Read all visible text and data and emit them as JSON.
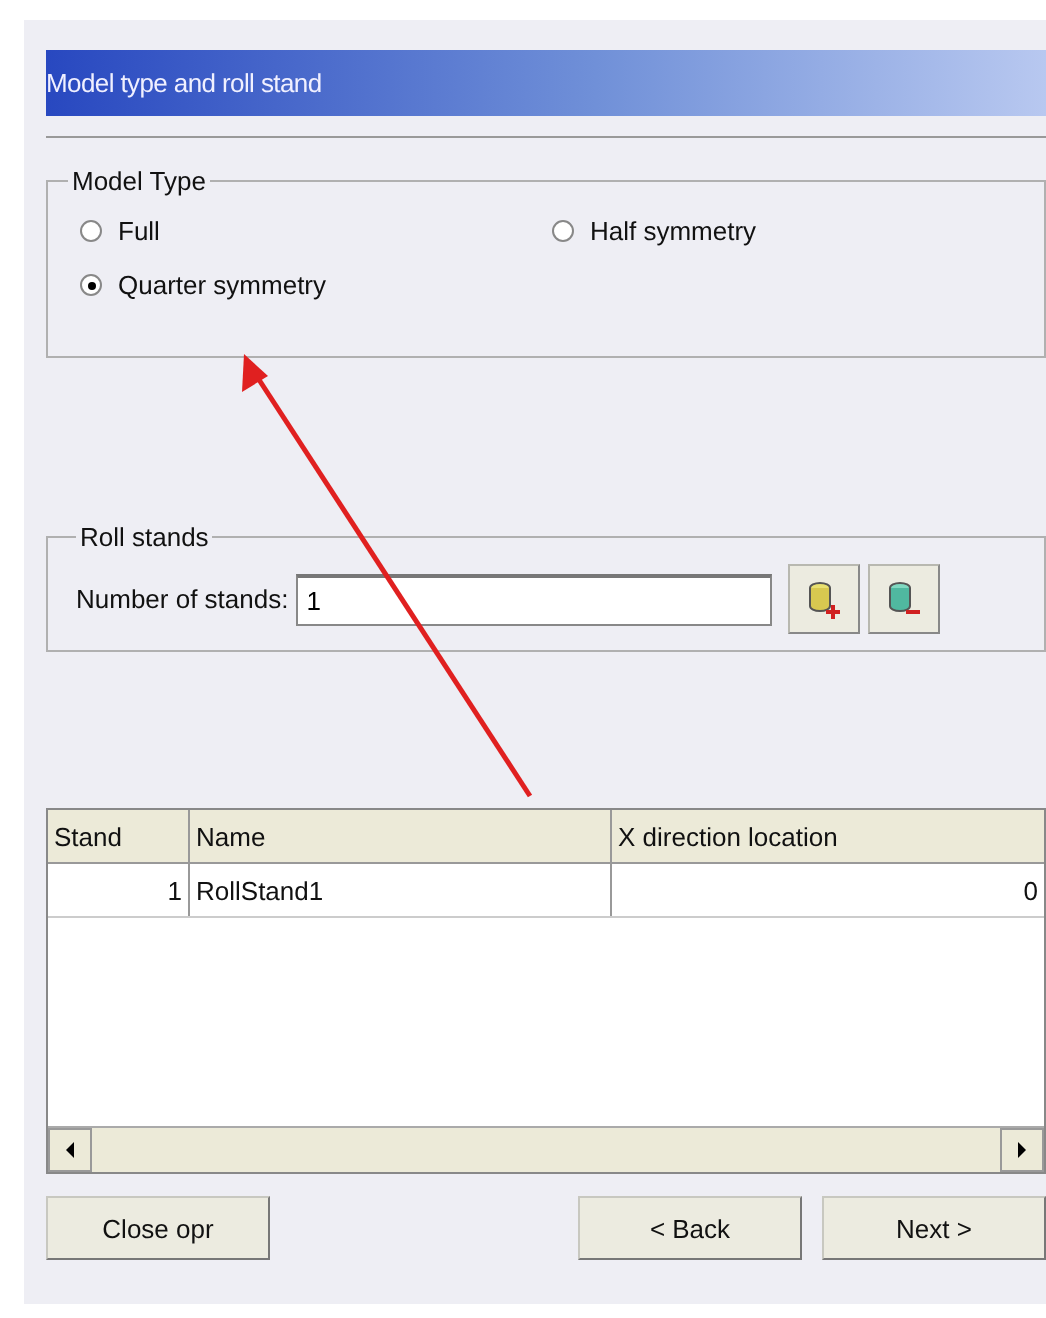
{
  "title_bar": {
    "title": "Model type and roll stand"
  },
  "model_type": {
    "legend": "Model Type",
    "options": [
      {
        "label": "Full",
        "selected": false
      },
      {
        "label": "Half symmetry",
        "selected": false
      },
      {
        "label": "Quarter symmetry",
        "selected": true
      }
    ]
  },
  "roll_stands": {
    "legend": "Roll stands",
    "field_label": "Number of stands:",
    "value": "1"
  },
  "table": {
    "columns": [
      "Stand",
      "Name",
      "X direction location"
    ],
    "rows": [
      [
        "1",
        "RollStand1",
        "0"
      ]
    ]
  },
  "buttons": {
    "left": "Close opr",
    "back": "< Back",
    "next": "Next >"
  }
}
